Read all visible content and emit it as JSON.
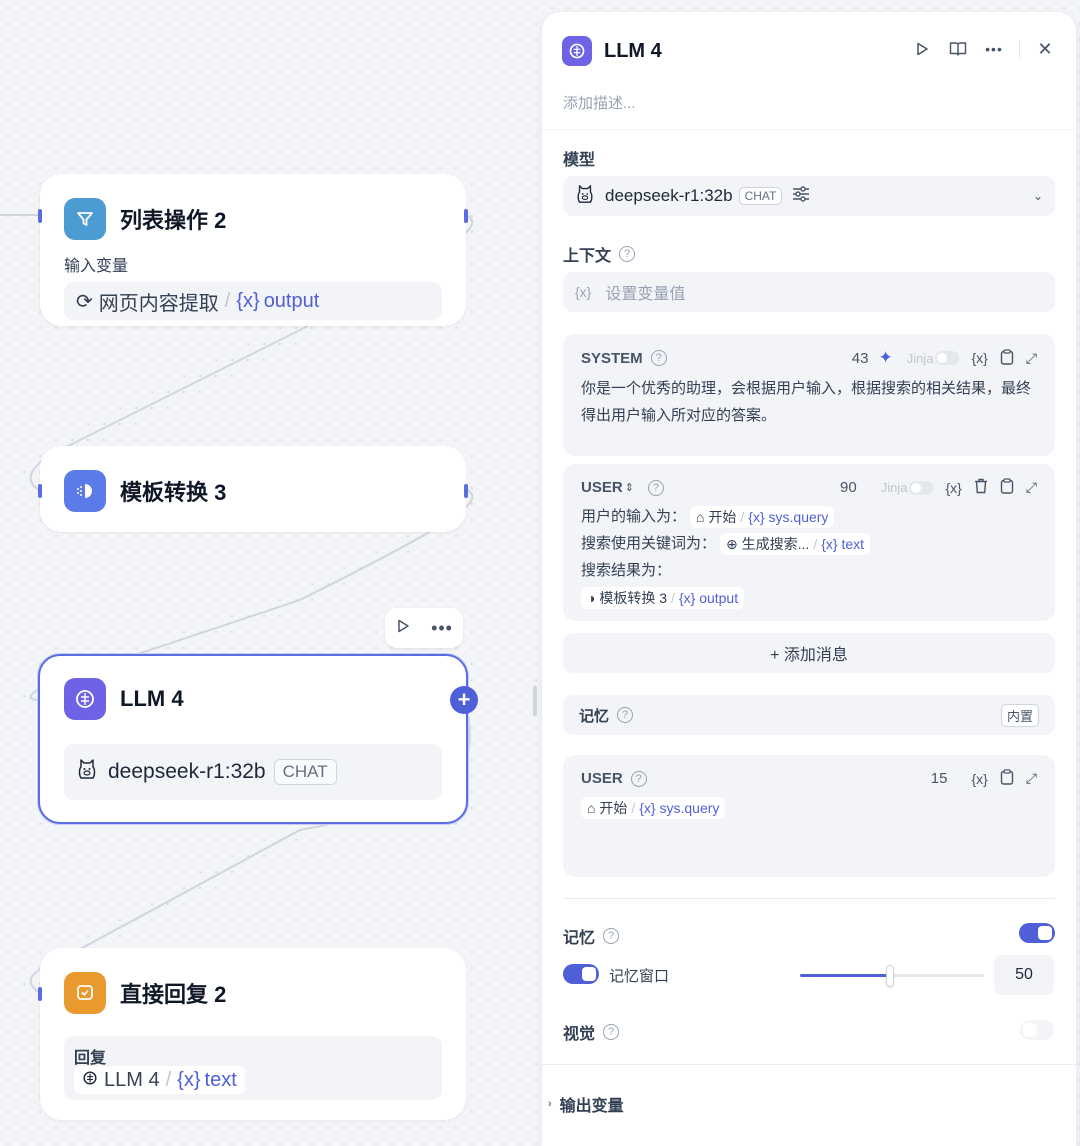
{
  "canvas": {
    "node_list": {
      "title": "列表操作 2",
      "sub_label": "输入变量",
      "var_node": "网页内容提取",
      "var_name": "output",
      "var_prefix": "{x}"
    },
    "node_template": {
      "title": "模板转换 3"
    },
    "node_llm": {
      "title": "LLM 4",
      "model": "deepseek-r1:32b",
      "mode": "CHAT"
    },
    "node_reply": {
      "title": "直接回复 2",
      "sub_label": "回复",
      "var_node": "LLM 4",
      "var_name": "text",
      "var_prefix": "{x}"
    }
  },
  "panel": {
    "title": "LLM 4",
    "description_placeholder": "添加描述...",
    "model_label": "模型",
    "model_name": "deepseek-r1:32b",
    "model_mode": "CHAT",
    "context_label": "上下文",
    "context_placeholder": "设置变量值",
    "context_prefix": "{x}",
    "system": {
      "role": "SYSTEM",
      "count": "43",
      "jinja": "Jinja",
      "text": "你是一个优秀的助理，会根据用户输入，根据搜索的相关结果，最终得出用户输入所对应的答案。"
    },
    "user": {
      "role": "USER",
      "count": "90",
      "jinja": "Jinja",
      "line1": "用户的输入为：",
      "line1_node": "开始",
      "line1_var": "sys.query",
      "line2": "搜索使用关键词为：",
      "line2_node": "生成搜索...",
      "line2_var": "text",
      "line3": "搜索结果为：",
      "line4_node": "模板转换 3",
      "line4_var": "output"
    },
    "add_message": "+ 添加消息",
    "memory_box_label": "记忆",
    "memory_builtin": "内置",
    "memory_user": {
      "role": "USER",
      "count": "15",
      "node": "开始",
      "var": "sys.query"
    },
    "memory_label": "记忆",
    "memory_window_label": "记忆窗口",
    "memory_window_value": "50",
    "memory_window_fraction": 0.49,
    "vision_label": "视觉",
    "output_vars_label": "输出变量",
    "var_prefix": "{x}"
  }
}
